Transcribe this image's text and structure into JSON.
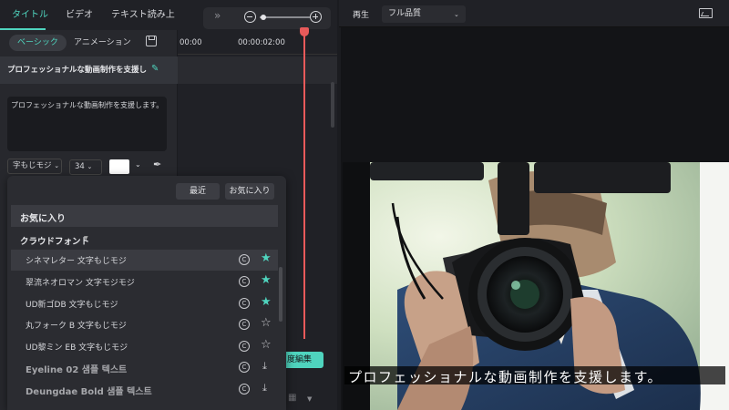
{
  "left_panel": {
    "tabs": [
      "タイトル",
      "ビデオ",
      "テキスト読み上"
    ],
    "active_tab": "タイトル",
    "subtabs": [
      "ベーシック",
      "アニメーション"
    ],
    "title_row": "プロフェッショナルな動画制作を支援し",
    "text_content": "プロフェッショナルな動画制作を支援します。",
    "font_select": "字もじモジ",
    "font_size": "34"
  },
  "timeline": {
    "timecodes": [
      "00:00",
      "00:00:02:00"
    ],
    "edit_button_label": "度編集"
  },
  "font_dropdown": {
    "buttons": [
      "最近",
      "お気に入り"
    ],
    "favorites_header": "お気に入り",
    "cloud_header": "クラウドフォント",
    "fonts": [
      {
        "name": "シネマレター 文字もじモジ",
        "status": "favorite",
        "selected": true
      },
      {
        "name": "翠流ネオロマン 文字モジモジ",
        "status": "favorite"
      },
      {
        "name": "UD新ゴDB 文字もじモジ",
        "status": "favorite"
      },
      {
        "name": "丸フォーク B 文字もじモジ",
        "status": "not-favorite"
      },
      {
        "name": "UD黎ミン EB 文字もじモジ",
        "status": "not-favorite"
      },
      {
        "name": "Eyeline 02 샘플 텍스트",
        "status": "download"
      },
      {
        "name": "Deungdae Bold 샘플 텍스트",
        "status": "download"
      }
    ],
    "accent_color": "#4fd4be"
  },
  "preview": {
    "play_label": "再生",
    "quality": "フル品質",
    "caption": "プロフェッショナルな動画制作を支援します。"
  }
}
